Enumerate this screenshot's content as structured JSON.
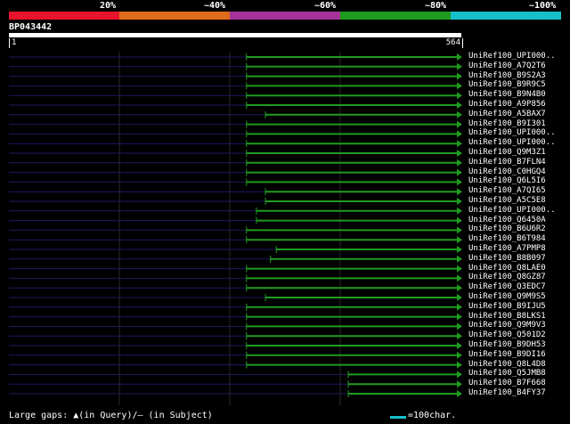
{
  "scale": {
    "labels": [
      "20%",
      "~40%",
      "~60%",
      "~80%",
      "~100%"
    ],
    "colors": [
      "#e8132d",
      "#e06b1a",
      "#a63399",
      "#1f9c1f",
      "#16bfca"
    ]
  },
  "query": {
    "id": "BP043442",
    "start": "1",
    "end": "564"
  },
  "hits": [
    {
      "label": "UniRef100_UPI000..",
      "start": 0.525,
      "end": 1.0
    },
    {
      "label": "UniRef100_A7Q2T6",
      "start": 0.525,
      "end": 1.0
    },
    {
      "label": "UniRef100_B9S2A3",
      "start": 0.525,
      "end": 1.0
    },
    {
      "label": "UniRef100_B9R9C5",
      "start": 0.525,
      "end": 1.0
    },
    {
      "label": "UniRef100_B9N4B0",
      "start": 0.525,
      "end": 1.0
    },
    {
      "label": "UniRef100_A9P856",
      "start": 0.525,
      "end": 1.0
    },
    {
      "label": "UniRef100_A5BAX7",
      "start": 0.567,
      "end": 1.0
    },
    {
      "label": "UniRef100_B9I301",
      "start": 0.525,
      "end": 1.0
    },
    {
      "label": "UniRef100_UPI000..",
      "start": 0.525,
      "end": 1.0
    },
    {
      "label": "UniRef100_UPI000..",
      "start": 0.525,
      "end": 1.0
    },
    {
      "label": "UniRef100_Q9M3Z1",
      "start": 0.525,
      "end": 1.0
    },
    {
      "label": "UniRef100_B7FLN4",
      "start": 0.525,
      "end": 1.0
    },
    {
      "label": "UniRef100_C0HGQ4",
      "start": 0.525,
      "end": 1.0
    },
    {
      "label": "UniRef100_Q6L5I6",
      "start": 0.525,
      "end": 1.0
    },
    {
      "label": "UniRef100_A7QI65",
      "start": 0.567,
      "end": 1.0
    },
    {
      "label": "UniRef100_A5C5E8",
      "start": 0.567,
      "end": 1.0
    },
    {
      "label": "UniRef100_UPI000..",
      "start": 0.547,
      "end": 1.0
    },
    {
      "label": "UniRef100_Q6450A",
      "start": 0.547,
      "end": 1.0
    },
    {
      "label": "UniRef100_B6U6R2",
      "start": 0.525,
      "end": 1.0
    },
    {
      "label": "UniRef100_B6T984",
      "start": 0.525,
      "end": 1.0
    },
    {
      "label": "UniRef100_A7PMP8",
      "start": 0.591,
      "end": 1.0
    },
    {
      "label": "UniRef100_B8B097",
      "start": 0.578,
      "end": 1.0
    },
    {
      "label": "UniRef100_Q8LAE0",
      "start": 0.525,
      "end": 1.0
    },
    {
      "label": "UniRef100_Q8GZ87",
      "start": 0.525,
      "end": 1.0
    },
    {
      "label": "UniRef100_Q3EDC7",
      "start": 0.525,
      "end": 1.0
    },
    {
      "label": "UniRef100_Q9M9S5",
      "start": 0.567,
      "end": 1.0
    },
    {
      "label": "UniRef100_B9IJU5",
      "start": 0.525,
      "end": 1.0
    },
    {
      "label": "UniRef100_B8LKS1",
      "start": 0.525,
      "end": 1.0
    },
    {
      "label": "UniRef100_Q9M9V3",
      "start": 0.525,
      "end": 1.0
    },
    {
      "label": "UniRef100_Q501D2",
      "start": 0.525,
      "end": 1.0
    },
    {
      "label": "UniRef100_B9DH53",
      "start": 0.525,
      "end": 1.0
    },
    {
      "label": "UniRef100_B9DI16",
      "start": 0.525,
      "end": 1.0
    },
    {
      "label": "UniRef100_Q8L4D8",
      "start": 0.525,
      "end": 1.0
    },
    {
      "label": "UniRef100_Q5JMB8",
      "start": 0.75,
      "end": 1.0
    },
    {
      "label": "UniRef100_B7F668",
      "start": 0.75,
      "end": 1.0
    },
    {
      "label": "UniRef100_B4FY37",
      "start": 0.75,
      "end": 1.0
    }
  ],
  "legend": {
    "gaps_text": "Large gaps: ▲(in Query)/— (in Subject)",
    "scale_text": "=100char.",
    "scale_color": "#16bfca"
  }
}
